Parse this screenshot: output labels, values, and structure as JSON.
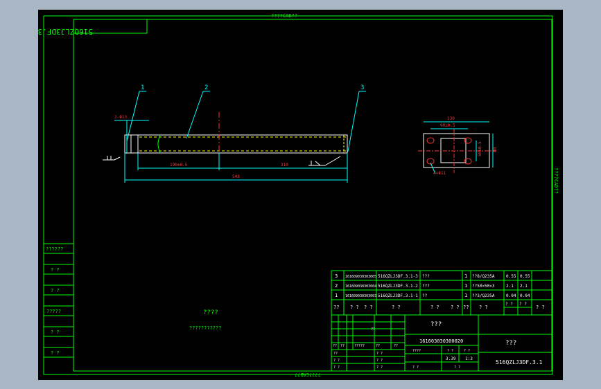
{
  "sheet": {
    "top_caption": "????CAD??",
    "bottom_caption": "????CAD??",
    "right_caption": "????CAD??",
    "drawing_code_top": "516QZLJ3DF.3.1"
  },
  "callouts": [
    "1",
    "2",
    "3"
  ],
  "dims": {
    "hole_note": "2-Φ13",
    "d1": "190±0.5",
    "d2": "310",
    "total": "548",
    "end_w": "130",
    "end_inner": "90±0.5",
    "end_h": "80",
    "end_inner_h": "50±0.5",
    "end_holes": "4×Φ11"
  },
  "bom": {
    "rows": [
      {
        "no": "3",
        "code": "161609030303005",
        "drawing": "516QZLJ3DF.3.1-3",
        "name": "???",
        "qty": "1",
        "material": "??8/Q235A",
        "w1": "0.55",
        "w2": "0.55"
      },
      {
        "no": "2",
        "code": "161609030303004",
        "drawing": "516QZLJ3DF.3.1-2",
        "name": "???",
        "qty": "1",
        "material": "??50×50×3",
        "w1": "2.1",
        "w2": "2.1"
      },
      {
        "no": "1",
        "code": "161609030303003",
        "drawing": "516QZLJ3DF.3.1-1",
        "name": "??",
        "qty": "1",
        "material": "??3/Q235A",
        "w1": "0.04",
        "w2": "0.04"
      }
    ],
    "header": [
      "??",
      "? ?",
      "? ?",
      "? ?",
      "? ?",
      "? ?",
      "??",
      "? ?",
      "? ?",
      "? ?",
      "? ?"
    ]
  },
  "title_block": {
    "name": "???",
    "code": "161603030300020",
    "company": "???",
    "drawing_no": "516QZLJ3DF.3.1",
    "scale": "1:3",
    "weight": "3.39",
    "small_labels": [
      "??",
      "??",
      "?????",
      "??",
      "??",
      "??",
      "? ?",
      "? ?",
      "? ?",
      "? ?",
      "? ?",
      "??",
      "????",
      "? ?",
      "? ?",
      "? ?",
      "? ?"
    ]
  },
  "left_strip": [
    "??????",
    "? ?",
    "? ?",
    "?????",
    "? ?",
    "? ?"
  ],
  "notes": {
    "title": "????",
    "body": "???????????"
  }
}
